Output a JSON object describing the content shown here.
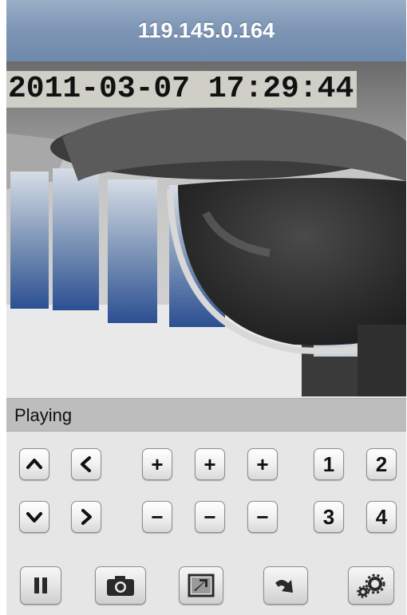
{
  "header": {
    "title": "119.145.0.164"
  },
  "video": {
    "timestamp": "2011-03-07 17:29:44"
  },
  "status": {
    "text": "Playing"
  },
  "ptz": {
    "plus_label": "+",
    "minus_label": "−"
  },
  "presets": [
    "1",
    "2",
    "3",
    "4"
  ],
  "toolbar": {
    "icons": [
      "pause-icon",
      "camera-icon",
      "fullscreen-icon",
      "rotate-arrow-icon",
      "gears-icon"
    ]
  }
}
